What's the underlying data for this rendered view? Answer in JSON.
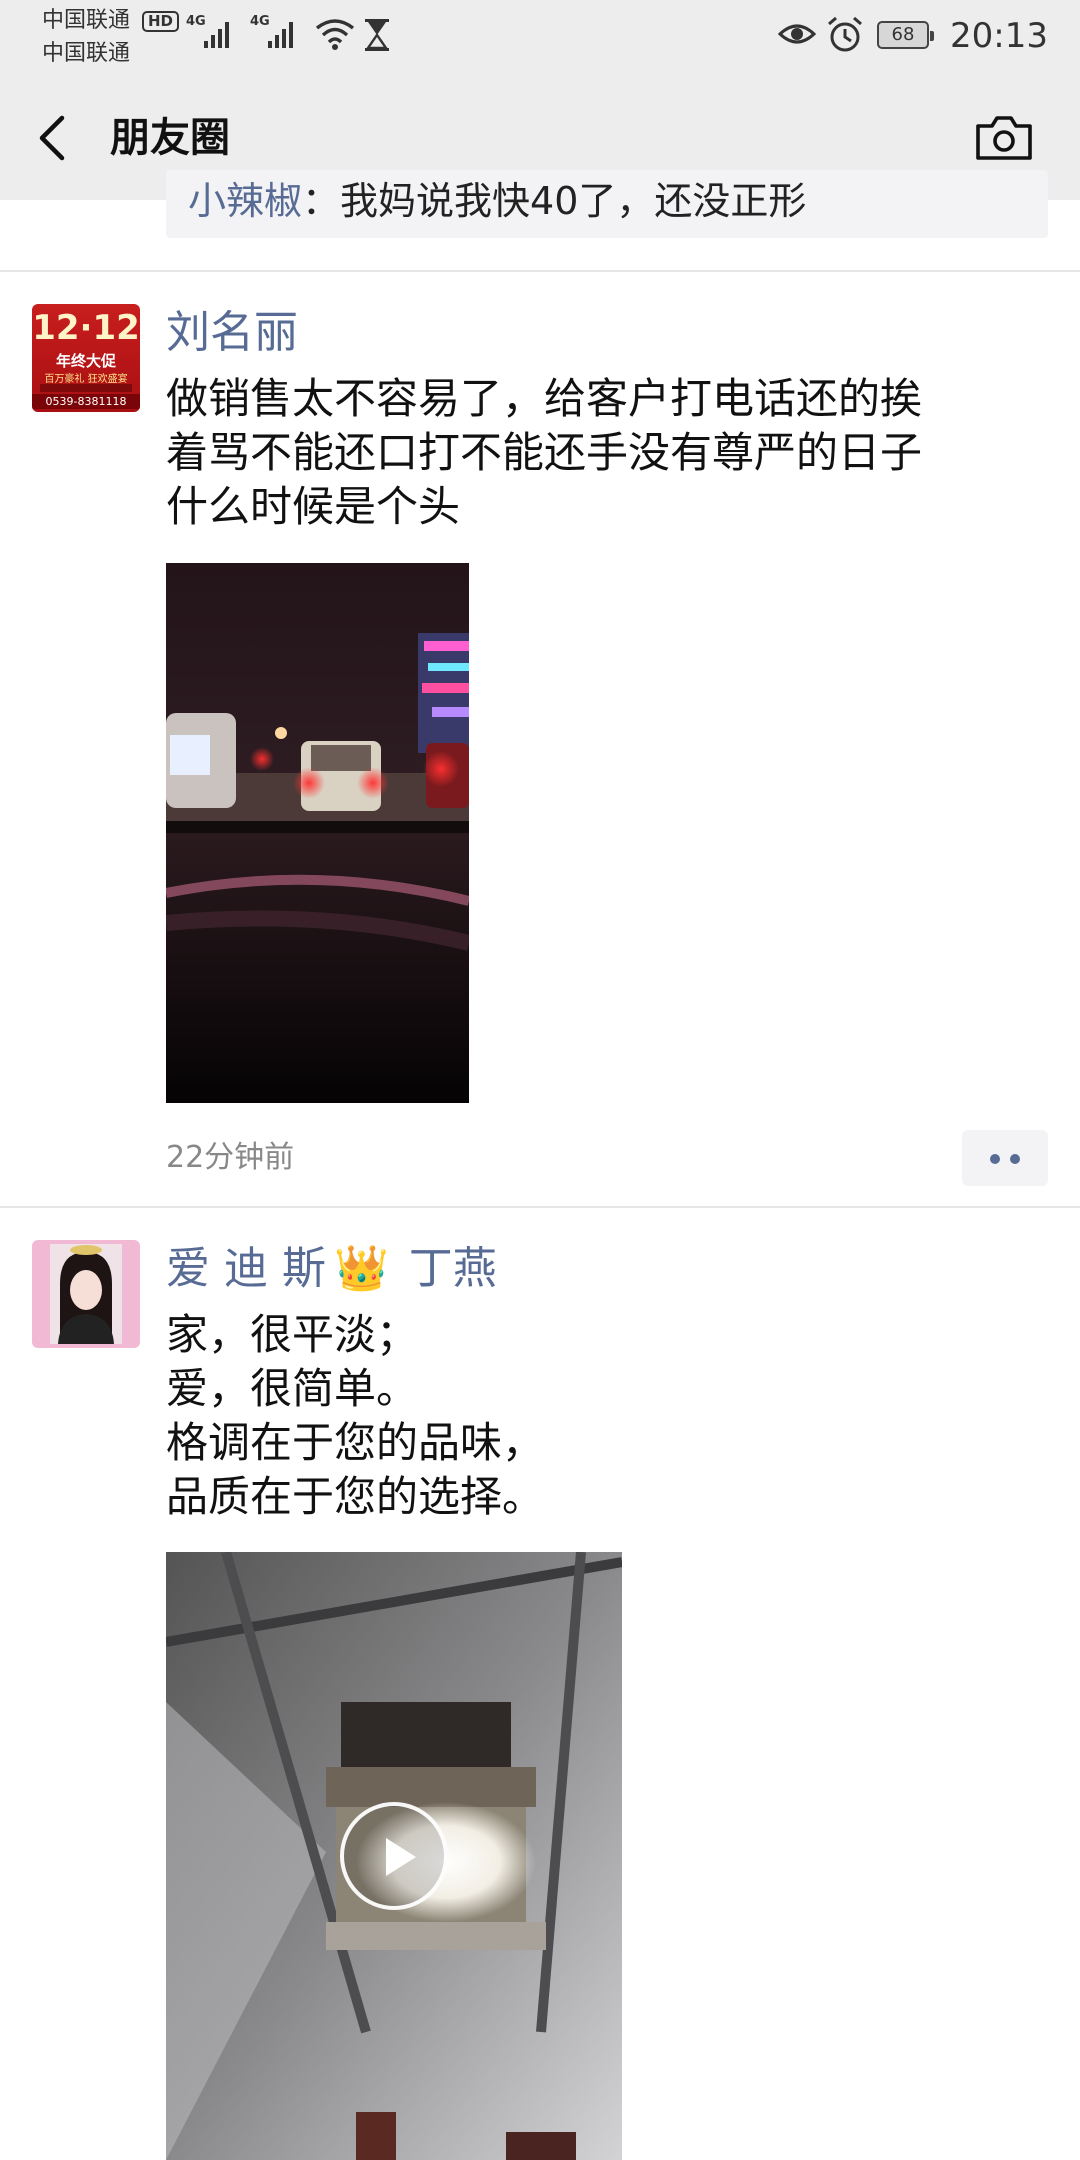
{
  "status_bar": {
    "carrier_1": "中国联通",
    "carrier_2": "中国联通",
    "hd_badge": "HD",
    "network_1": "4G",
    "network_2": "4G",
    "icons": [
      "signal-icon",
      "wifi-icon",
      "hourglass-icon",
      "eye-icon",
      "alarm-icon",
      "battery-icon"
    ],
    "battery_level": "68",
    "time": "20:13"
  },
  "nav": {
    "title": "朋友圈",
    "back_icon": "chevron-left-icon",
    "camera_icon": "camera-icon"
  },
  "previous_comment": {
    "nickname": "小辣椒",
    "text": "：我妈说我快40了，还没正形"
  },
  "posts": [
    {
      "author": "刘名丽",
      "text": "做销售太不容易了，给客户打电话还的挨\n着骂不能还口打不能还手没有尊严的日子\n什么时候是个头",
      "avatar_lines": [
        "12·12",
        "年终大促",
        "百万豪礼 狂欢盛宴",
        "0539-8381118"
      ],
      "time_ago": "22分钟前",
      "media_type": "image"
    },
    {
      "author": "爱 迪 斯",
      "author_emoji": "👑",
      "author_suffix": "丁燕",
      "text": "家，很平淡；\n爱，很简单。\n格调在于您的品味，\n品质在于您的选择。",
      "media_type": "video"
    }
  ],
  "colors": {
    "nickname": "#576b95",
    "bar_bg": "#ededed",
    "divider": "#e6e6e6"
  }
}
